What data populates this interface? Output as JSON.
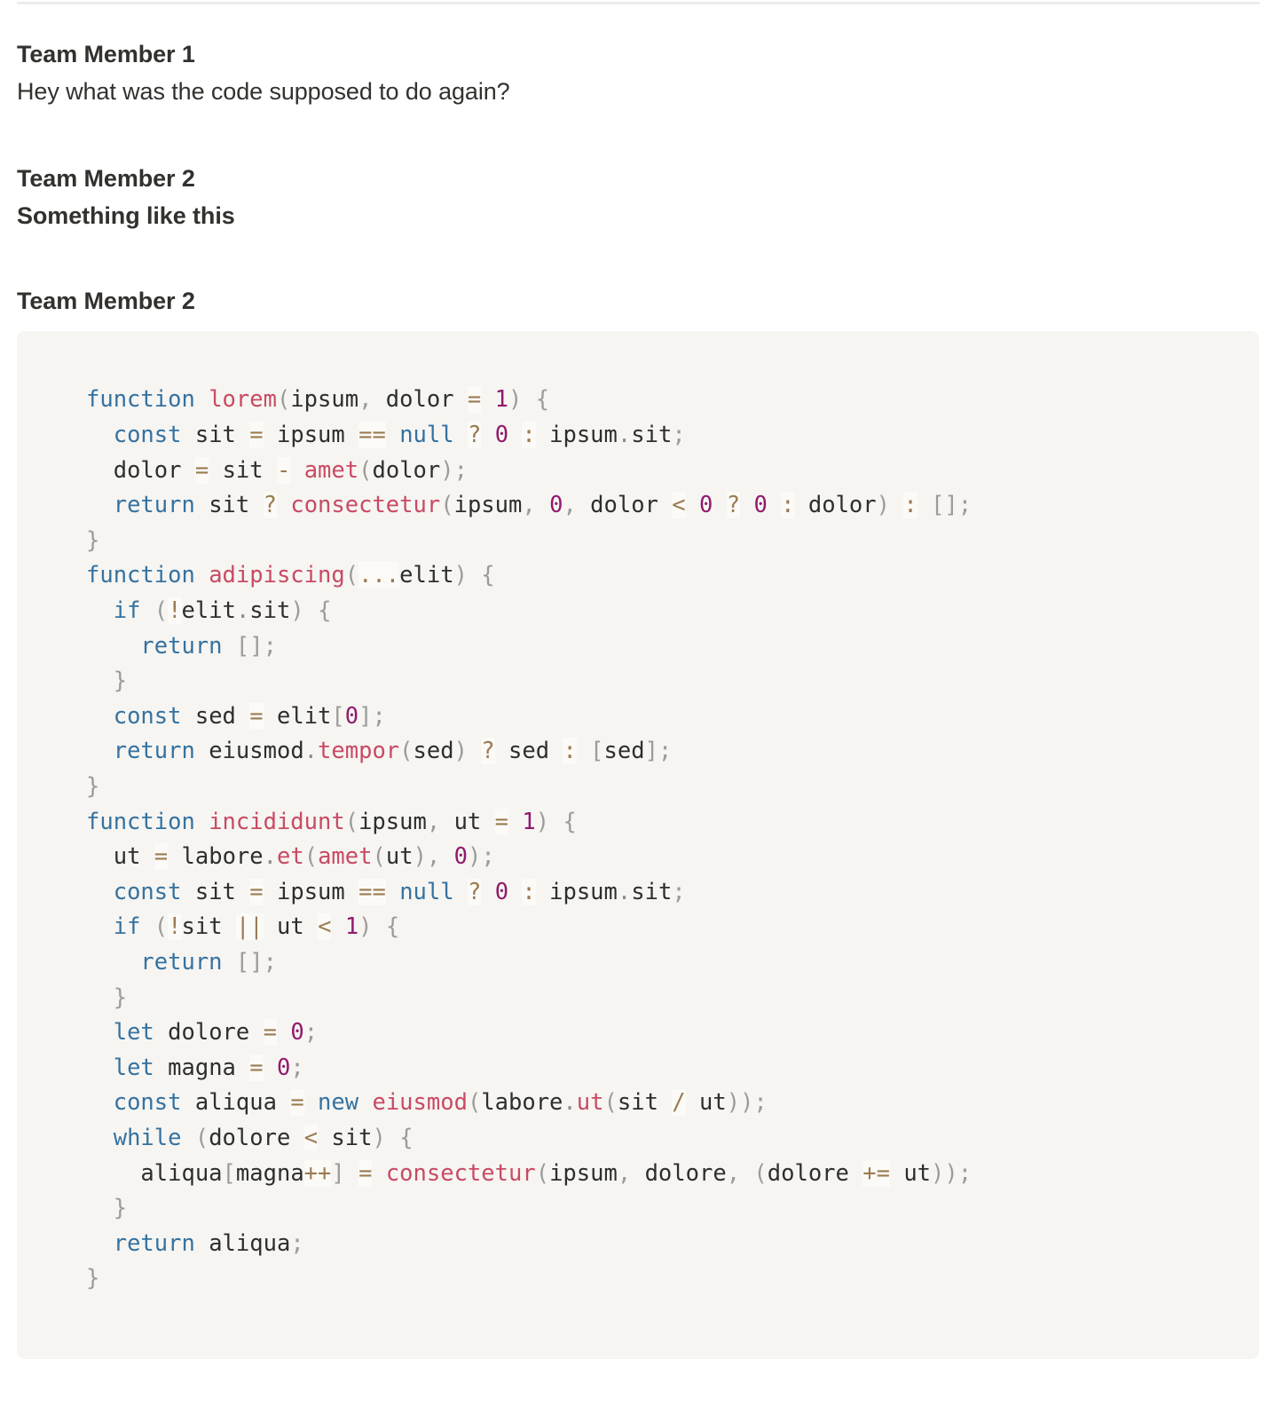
{
  "conversation": [
    {
      "speaker": "Team Member 1",
      "text": "Hey what was the code supposed to do again?",
      "bold": false
    },
    {
      "speaker": "Team Member 2",
      "text": "Something like this",
      "bold": true
    },
    {
      "speaker": "Team Member 2",
      "text": "",
      "bold": false
    }
  ],
  "code_block": {
    "language": "javascript",
    "background_color": "#f6f5f2",
    "lines": [
      "function lorem(ipsum, dolor = 1) {",
      "  const sit = ipsum == null ? 0 : ipsum.sit;",
      "  dolor = sit - amet(dolor);",
      "  return sit ? consectetur(ipsum, 0, dolor < 0 ? 0 : dolor) : [];",
      "}",
      "function adipiscing(...elit) {",
      "  if (!elit.sit) {",
      "    return [];",
      "  }",
      "  const sed = elit[0];",
      "  return eiusmod.tempor(sed) ? sed : [sed];",
      "}",
      "function incididunt(ipsum, ut = 1) {",
      "  ut = labore.et(amet(ut), 0);",
      "  const sit = ipsum == null ? 0 : ipsum.sit;",
      "  if (!sit || ut < 1) {",
      "    return [];",
      "  }",
      "  let dolore = 0;",
      "  let magna = 0;",
      "  const aliqua = new eiusmod(labore.ut(sit / ut));",
      "  while (dolore < sit) {",
      "    aliqua[magna++] = consectetur(ipsum, dolore, (dolore += ut));",
      "  }",
      "  return aliqua;",
      "}"
    ],
    "syntax_colors": {
      "keyword": "#3572a0",
      "function_name": "#c94a63",
      "number": "#911a6d",
      "operator": "#9a7b52",
      "punctuation": "#9b9b99",
      "identifier": "#2e2e2e"
    }
  },
  "theme": {
    "page_background": "#ffffff",
    "text_color": "#33312e",
    "divider_color": "#ececec"
  }
}
